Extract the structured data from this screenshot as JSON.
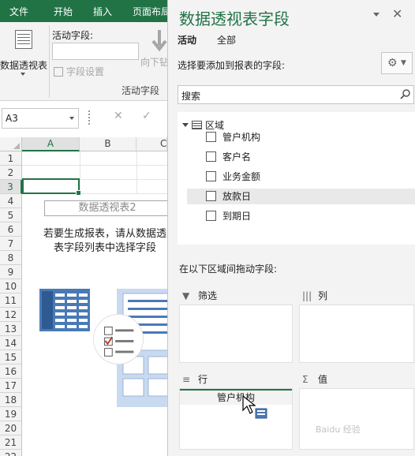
{
  "ribbon": {
    "tabs": [
      "文件",
      "开始",
      "插入",
      "页面布局"
    ],
    "pivot_table_label": "数据透视表",
    "active_field_label": "活动字段:",
    "active_field_value": "",
    "field_settings_label": "字段设置",
    "drill_down_label": "向下钻",
    "group_label": "活动字段"
  },
  "formula_bar": {
    "name_box": "A3",
    "cancel_icon": "✕",
    "enter_icon": "✓"
  },
  "sheet": {
    "columns": [
      "A",
      "B",
      "C"
    ],
    "active_column": "A",
    "rows": [
      "1",
      "2",
      "3",
      "4",
      "5",
      "6",
      "7",
      "8",
      "9",
      "10",
      "11",
      "12",
      "13",
      "14",
      "15",
      "16",
      "17",
      "18",
      "19",
      "20",
      "21",
      "22"
    ],
    "active_row": "3",
    "pivot_placeholder_title": "数据透视表2",
    "pivot_instruction_line1": "若要生成报表，请从数据透",
    "pivot_instruction_line2": "表字段列表中选择字段"
  },
  "panel": {
    "title": "数据透视表字段",
    "close_icon": "✕",
    "tab_active": "活动",
    "tab_all": "全部",
    "choose_label": "选择要添加到报表的字段:",
    "settings_icon": "⚙",
    "search_placeholder": "搜索",
    "tree_root": "区域",
    "fields": [
      "管户机构",
      "客户名",
      "业务金额",
      "放款日",
      "到期日"
    ],
    "drag_label": "在以下区域间拖动字段:",
    "areas": {
      "filter": {
        "icon": "▼",
        "label": "筛选"
      },
      "columns": {
        "icon": "|||",
        "label": "列"
      },
      "rows": {
        "icon": "≡",
        "label": "行",
        "item": "管户机构"
      },
      "values": {
        "icon": "Σ",
        "label": "值"
      }
    }
  },
  "colors": {
    "excel_green": "#217346",
    "panel_bg": "#f3f3f3"
  },
  "watermark": "Baidu 经验"
}
